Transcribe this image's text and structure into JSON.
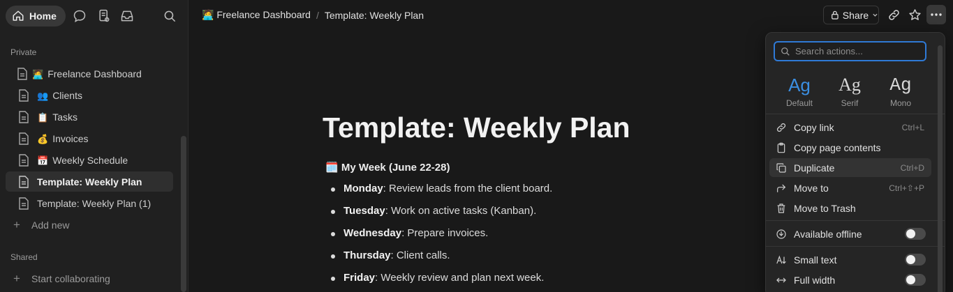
{
  "sidebar": {
    "home_label": "Home",
    "private_label": "Private",
    "shared_label": "Shared",
    "add_new_label": "Add new",
    "start_collab_label": "Start collaborating",
    "items": [
      {
        "emoji": "🧑‍💻",
        "label": "Freelance Dashboard"
      },
      {
        "emoji": "👥",
        "label": "Clients"
      },
      {
        "emoji": "📋",
        "label": "Tasks"
      },
      {
        "emoji": "💰",
        "label": "Invoices"
      },
      {
        "emoji": "📅",
        "label": "Weekly Schedule"
      },
      {
        "emoji": "",
        "label": "Template: Weekly Plan"
      },
      {
        "emoji": "",
        "label": "Template: Weekly Plan (1)"
      }
    ]
  },
  "topbar": {
    "crumb_emoji": "🧑‍💻",
    "crumb_parent": "Freelance Dashboard",
    "crumb_sep": "/",
    "crumb_current": "Template: Weekly Plan",
    "share_label": "Share"
  },
  "page": {
    "title": "Template: Weekly Plan",
    "week_heading_emoji": "🗓️",
    "week_heading": "My Week (June 22-28)",
    "days": [
      {
        "day": "Monday",
        "text": ": Review leads from the client board."
      },
      {
        "day": "Tuesday",
        "text": ": Work on active tasks (Kanban)."
      },
      {
        "day": "Wednesday",
        "text": ": Prepare invoices."
      },
      {
        "day": "Thursday",
        "text": ": Client calls."
      },
      {
        "day": "Friday",
        "text": ": Weekly review and plan next week."
      }
    ]
  },
  "menu": {
    "search_placeholder": "Search actions...",
    "fonts": [
      {
        "sample": "Ag",
        "label": "Default"
      },
      {
        "sample": "Ag",
        "label": "Serif"
      },
      {
        "sample": "Ag",
        "label": "Mono"
      }
    ],
    "items": [
      {
        "label": "Copy link",
        "shortcut": "Ctrl+L"
      },
      {
        "label": "Copy page contents",
        "shortcut": ""
      },
      {
        "label": "Duplicate",
        "shortcut": "Ctrl+D"
      },
      {
        "label": "Move to",
        "shortcut": "Ctrl+⇧+P"
      },
      {
        "label": "Move to Trash",
        "shortcut": ""
      }
    ],
    "toggles": [
      {
        "label": "Available offline"
      },
      {
        "label": "Small text"
      },
      {
        "label": "Full width"
      }
    ]
  },
  "colors": {
    "accent": "#2f7ad6",
    "selected_font": "#3b8ee0",
    "background": "#191919",
    "sidebar": "#202020"
  }
}
